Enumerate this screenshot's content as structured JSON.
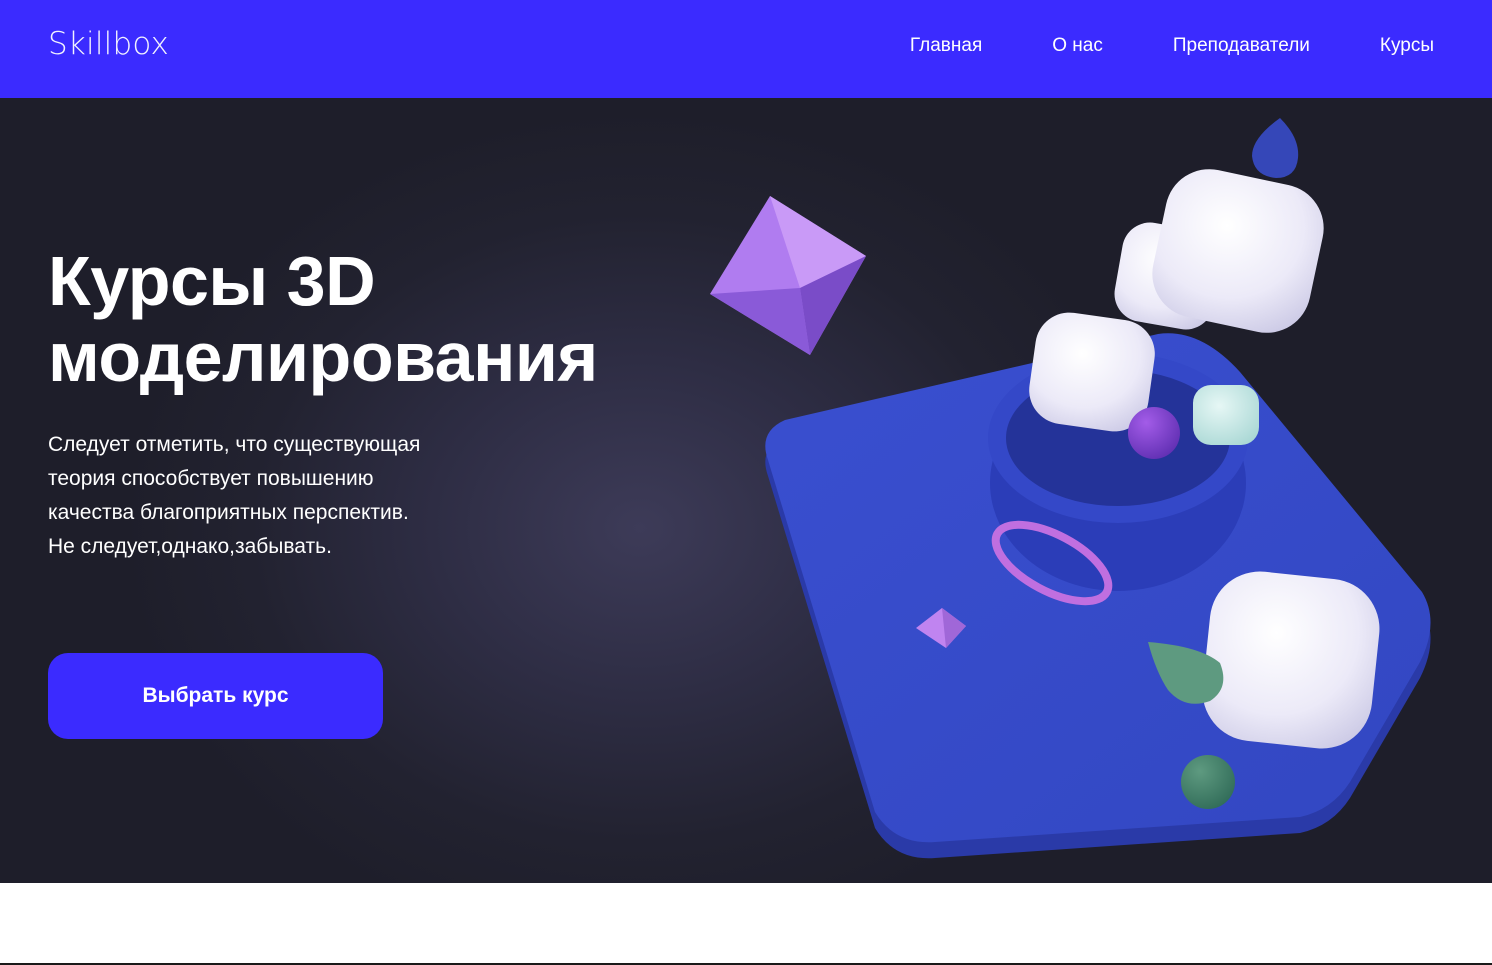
{
  "header": {
    "logo_text": "Skillbox",
    "background_color": "#3b2bff",
    "nav": [
      {
        "label": "Главная"
      },
      {
        "label": "О нас"
      },
      {
        "label": "Преподаватели"
      },
      {
        "label": "Курсы"
      }
    ]
  },
  "hero": {
    "title_line1": "Курсы 3D",
    "title_line2": "моделирования",
    "description_lines": [
      "Следует отметить, что существующая",
      "теория способствует повышению",
      "качества благоприятных перспектив.",
      "Не следует,однако,забывать."
    ],
    "cta_label": "Выбрать курс",
    "cta_color": "#3b2bff",
    "illustration_icon": "3d-shapes-composition-icon"
  }
}
